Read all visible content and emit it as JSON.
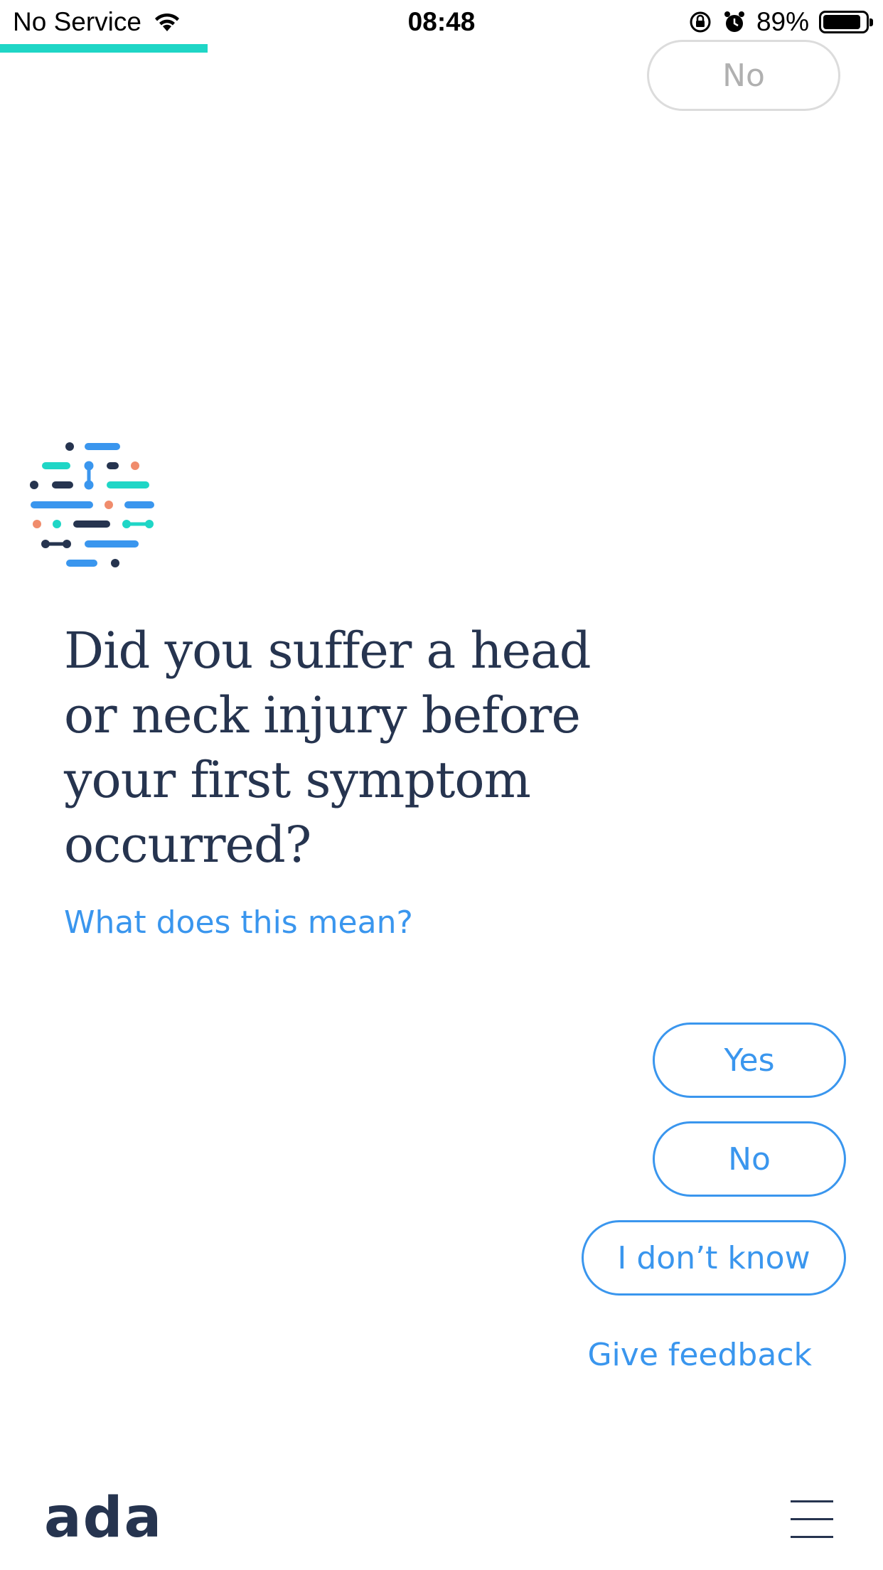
{
  "status_bar": {
    "carrier": "No Service",
    "time": "08:48",
    "battery_percent": "89%",
    "battery_level": 0.89,
    "icons": [
      "wifi-icon",
      "orientation-lock-icon",
      "alarm-icon",
      "battery-icon"
    ]
  },
  "progress": {
    "value": 0.235,
    "color": "#1fd6c6"
  },
  "previous_answer": {
    "label": "No"
  },
  "question": {
    "text": "Did you suffer a head or neck injury before your first symptom occurred?",
    "help_link": "What does this mean?"
  },
  "answers": {
    "yes": "Yes",
    "no": "No",
    "dont_know": "I don’t know"
  },
  "feedback": {
    "label": "Give feedback"
  },
  "footer": {
    "logo": "ada",
    "menu_icon": "hamburger-menu-icon"
  },
  "colors": {
    "accent": "#3a96ee",
    "text_dark": "#26344f",
    "teal": "#1fd6c6",
    "coral": "#f08c6c"
  }
}
